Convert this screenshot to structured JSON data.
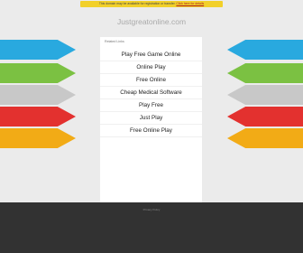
{
  "banner": {
    "notice_text": "This domain may be available for registration or transfer.",
    "notice_link": "Click here for details"
  },
  "header": {
    "domain": "Justgreatonline.com"
  },
  "main": {
    "related_label": "Related Links",
    "links": [
      "Play Free Game Online",
      "Online Play",
      "Free Online",
      "Cheap Medical Software",
      "Play Free",
      "Just Play",
      "Free Online Play"
    ]
  },
  "decor": {
    "arrow_colors": [
      "#29a9df",
      "#7bc142",
      "#c8c8c8",
      "#e3312f",
      "#f2ab16"
    ]
  },
  "footer": {
    "text": "Privacy Policy"
  }
}
